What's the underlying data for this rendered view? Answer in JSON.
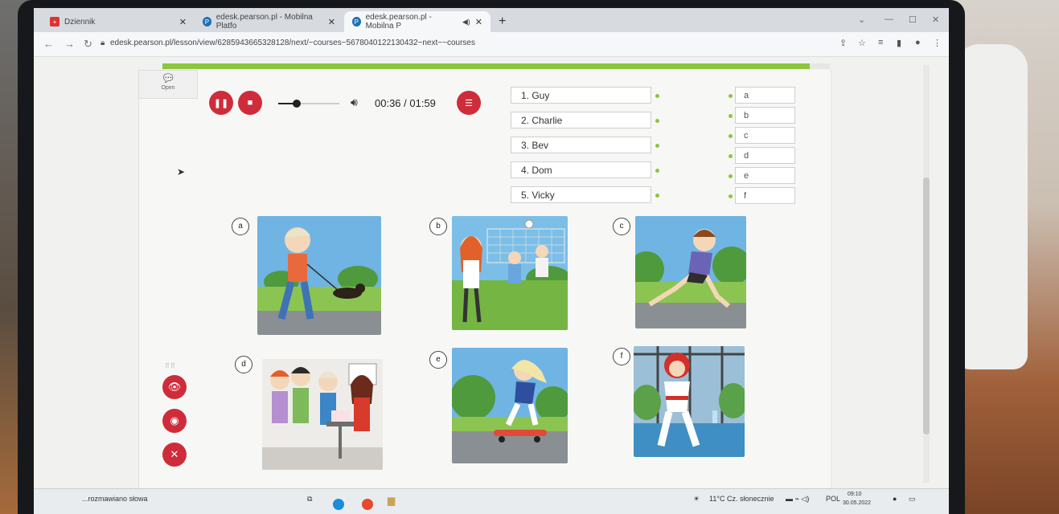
{
  "browser": {
    "tabs": [
      {
        "title": "Dziennik",
        "icon": "dziennik-icon",
        "active": false
      },
      {
        "title": "edesk.pearson.pl - Mobilna Platfo",
        "icon": "pearson-icon",
        "active": false
      },
      {
        "title": "edesk.pearson.pl - Mobilna P",
        "icon": "pearson-icon",
        "active": true
      }
    ],
    "url": "edesk.pearson.pl/lesson/view/6285943665328128/next/~courses~5678040122130432~next~~courses"
  },
  "page": {
    "progress_fraction": 0.97,
    "open_widget_label": "Open",
    "player": {
      "time": "00:36 / 01:59",
      "position_fraction": 0.3
    },
    "names": [
      "1. Guy",
      "2. Charlie",
      "3. Bev",
      "4. Dom",
      "5. Vicky"
    ],
    "letters": [
      "a",
      "b",
      "c",
      "d",
      "e",
      "f"
    ],
    "pictures": [
      {
        "label": "a",
        "depicts": "boy-walking-dog"
      },
      {
        "label": "b",
        "depicts": "volleyball"
      },
      {
        "label": "c",
        "depicts": "boy-running"
      },
      {
        "label": "d",
        "depicts": "birthday-party"
      },
      {
        "label": "e",
        "depicts": "girl-skateboarding"
      },
      {
        "label": "f",
        "depicts": "karate"
      }
    ]
  },
  "taskbar": {
    "search_text": "...rozmawiano słowa",
    "weather": "11°C  Cz. słonecznie",
    "lang": "POL",
    "clock_time": "09:10",
    "clock_date": "30.05.2022"
  },
  "colors": {
    "accent_red": "#cf2c3b",
    "accent_green": "#8cc63f"
  }
}
